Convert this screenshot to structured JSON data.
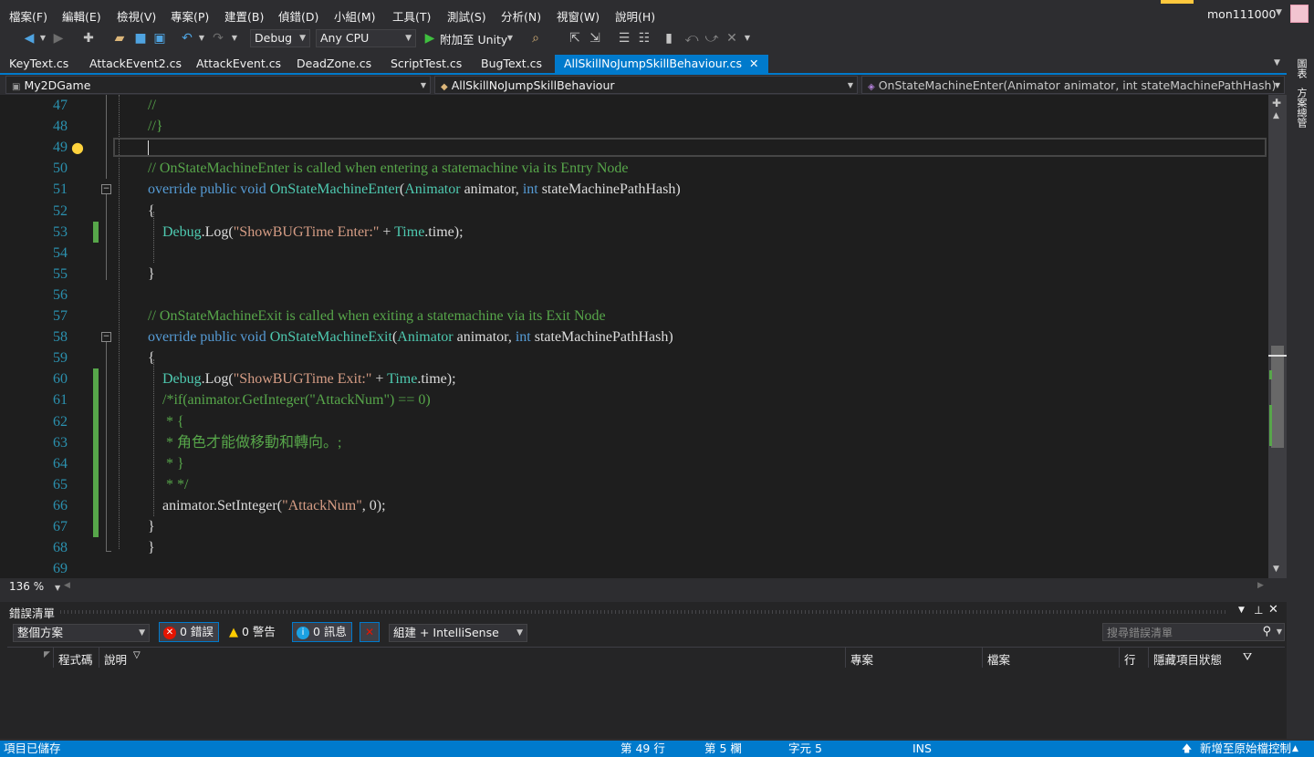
{
  "menu": [
    "檔案(F)",
    "編輯(E)",
    "檢視(V)",
    "專案(P)",
    "建置(B)",
    "偵錯(D)",
    "小組(M)",
    "工具(T)",
    "測試(S)",
    "分析(N)",
    "視窗(W)",
    "說明(H)"
  ],
  "user": "mon111000",
  "toolbar": {
    "config": "Debug",
    "platform": "Any CPU",
    "attach_label": "附加至 Unity"
  },
  "tabs": [
    "KeyText.cs",
    "AttackEvent2.cs",
    "AttackEvent.cs",
    "DeadZone.cs",
    "ScriptTest.cs",
    "BugText.cs",
    "AllSkillNoJumpSkillBehaviour.cs"
  ],
  "nav": {
    "project": "My2DGame",
    "class": "AllSkillNoJumpSkillBehaviour",
    "member": "OnStateMachineEnter(Animator animator, int stateMachinePathHash)"
  },
  "editor": {
    "zoom": "136 %",
    "lines": [
      {
        "n": "47",
        "segs": [
          {
            "c": "c",
            "t": "//"
          }
        ]
      },
      {
        "n": "48",
        "segs": [
          {
            "c": "c",
            "t": "//}"
          }
        ]
      },
      {
        "n": "49",
        "segs": []
      },
      {
        "n": "50",
        "segs": [
          {
            "c": "c",
            "t": "// OnStateMachineEnter is called when entering a statemachine via its Entry Node"
          }
        ]
      },
      {
        "n": "51",
        "segs": [
          {
            "c": "k",
            "t": "override public void "
          },
          {
            "c": "t",
            "t": "OnStateMachineEnter"
          },
          {
            "c": "p",
            "t": "("
          },
          {
            "c": "t",
            "t": "Animator"
          },
          {
            "c": "p",
            "t": " animator, "
          },
          {
            "c": "k",
            "t": "int"
          },
          {
            "c": "p",
            "t": " stateMachinePathHash)"
          }
        ]
      },
      {
        "n": "52",
        "segs": [
          {
            "c": "p",
            "t": "{"
          }
        ]
      },
      {
        "n": "53",
        "segs": [
          {
            "c": "p",
            "t": "    "
          },
          {
            "c": "t",
            "t": "Debug"
          },
          {
            "c": "p",
            "t": ".Log("
          },
          {
            "c": "s",
            "t": "\"ShowBUGTime Enter:\""
          },
          {
            "c": "p",
            "t": " + "
          },
          {
            "c": "t",
            "t": "Time"
          },
          {
            "c": "p",
            "t": ".time);"
          }
        ]
      },
      {
        "n": "54",
        "segs": []
      },
      {
        "n": "55",
        "segs": [
          {
            "c": "p",
            "t": "}"
          }
        ]
      },
      {
        "n": "56",
        "segs": []
      },
      {
        "n": "57",
        "segs": [
          {
            "c": "c",
            "t": "// OnStateMachineExit is called when exiting a statemachine via its Exit Node"
          }
        ]
      },
      {
        "n": "58",
        "segs": [
          {
            "c": "k",
            "t": "override public void "
          },
          {
            "c": "t",
            "t": "OnStateMachineExit"
          },
          {
            "c": "p",
            "t": "("
          },
          {
            "c": "t",
            "t": "Animator"
          },
          {
            "c": "p",
            "t": " animator, "
          },
          {
            "c": "k",
            "t": "int"
          },
          {
            "c": "p",
            "t": " stateMachinePathHash)"
          }
        ]
      },
      {
        "n": "59",
        "segs": [
          {
            "c": "p",
            "t": "{"
          }
        ]
      },
      {
        "n": "60",
        "segs": [
          {
            "c": "p",
            "t": "    "
          },
          {
            "c": "t",
            "t": "Debug"
          },
          {
            "c": "p",
            "t": ".Log("
          },
          {
            "c": "s",
            "t": "\"ShowBUGTime Exit:\""
          },
          {
            "c": "p",
            "t": " + "
          },
          {
            "c": "t",
            "t": "Time"
          },
          {
            "c": "p",
            "t": ".time);"
          }
        ]
      },
      {
        "n": "61",
        "segs": [
          {
            "c": "c",
            "t": "    /*if(animator.GetInteger(\"AttackNum\") == 0)"
          }
        ]
      },
      {
        "n": "62",
        "segs": [
          {
            "c": "c",
            "t": "     * {"
          }
        ]
      },
      {
        "n": "63",
        "segs": [
          {
            "c": "c",
            "t": "     * 角色才能做移動和轉向。;"
          }
        ]
      },
      {
        "n": "64",
        "segs": [
          {
            "c": "c",
            "t": "     * }"
          }
        ]
      },
      {
        "n": "65",
        "segs": [
          {
            "c": "c",
            "t": "     * */"
          }
        ]
      },
      {
        "n": "66",
        "segs": [
          {
            "c": "p",
            "t": "    animator.SetInteger("
          },
          {
            "c": "s",
            "t": "\"AttackNum\""
          },
          {
            "c": "p",
            "t": ", 0);"
          }
        ]
      },
      {
        "n": "67",
        "segs": [
          {
            "c": "p",
            "t": "}"
          }
        ]
      },
      {
        "n": "68",
        "segs": [
          {
            "c": "p",
            "t": "}"
          }
        ]
      },
      {
        "n": "69",
        "segs": []
      }
    ]
  },
  "side_tabs": [
    "圖表",
    "方案總管"
  ],
  "error_list": {
    "title": "錯誤清單",
    "scope": "整個方案",
    "errors": "0 錯誤",
    "warnings": "0 警告",
    "messages": "0 訊息",
    "build_filter": "組建 + IntelliSense",
    "search_placeholder": "搜尋錯誤清單",
    "columns": [
      "程式碼",
      "說明",
      "專案",
      "檔案",
      "行",
      "隱藏項目狀態"
    ]
  },
  "status": {
    "left": "項目已儲存",
    "line": "第 49 行",
    "col": "第 5 欄",
    "char": "字元 5",
    "mode": "INS",
    "source_control": "新增至原始檔控制"
  },
  "colors": {
    "accent": "#007acc",
    "editor_bg": "#1e1e1e",
    "keyword": "#569cd6",
    "type": "#4ec9b0",
    "string": "#d69d85",
    "comment": "#57a64a",
    "line_number": "#2b91af"
  }
}
